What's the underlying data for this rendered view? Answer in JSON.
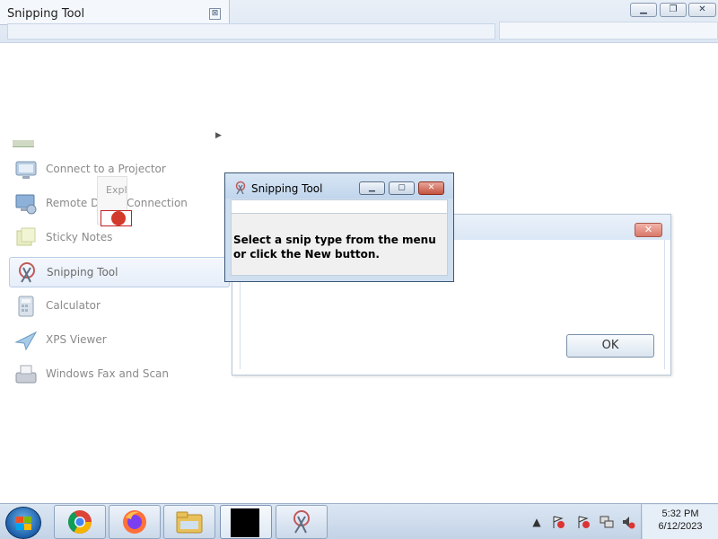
{
  "bg_window": {
    "tab_title": "Snipping Tool"
  },
  "start_menu": {
    "items": [
      {
        "label": "Connect to a Projector",
        "icon": "projector-icon"
      },
      {
        "label": "Remote De",
        "label2": "Connection",
        "icon": "remote-desktop-icon"
      },
      {
        "label": "Sticky Notes",
        "icon": "sticky-notes-icon"
      },
      {
        "label": "Snipping Tool",
        "icon": "snipping-tool-icon",
        "selected": true
      },
      {
        "label": "Calculator",
        "icon": "calculator-icon"
      },
      {
        "label": "XPS Viewer",
        "icon": "xps-viewer-icon"
      },
      {
        "label": "Windows Fax and Scan",
        "icon": "fax-scan-icon"
      }
    ],
    "ghost_text": "Expl"
  },
  "dialog_back": {
    "ok_label": "OK"
  },
  "snip_window": {
    "title": "Snipping Tool",
    "message": "Select a snip type from the menu or click the New button."
  },
  "taskbar": {
    "apps": [
      "chrome",
      "firefox",
      "file-explorer",
      "terminal",
      "snipping-tool"
    ],
    "time": "5:32 PM",
    "date": "6/12/2023"
  },
  "colors": {
    "close_red": "#c4533f",
    "accent_blue": "#1c5ea8"
  }
}
